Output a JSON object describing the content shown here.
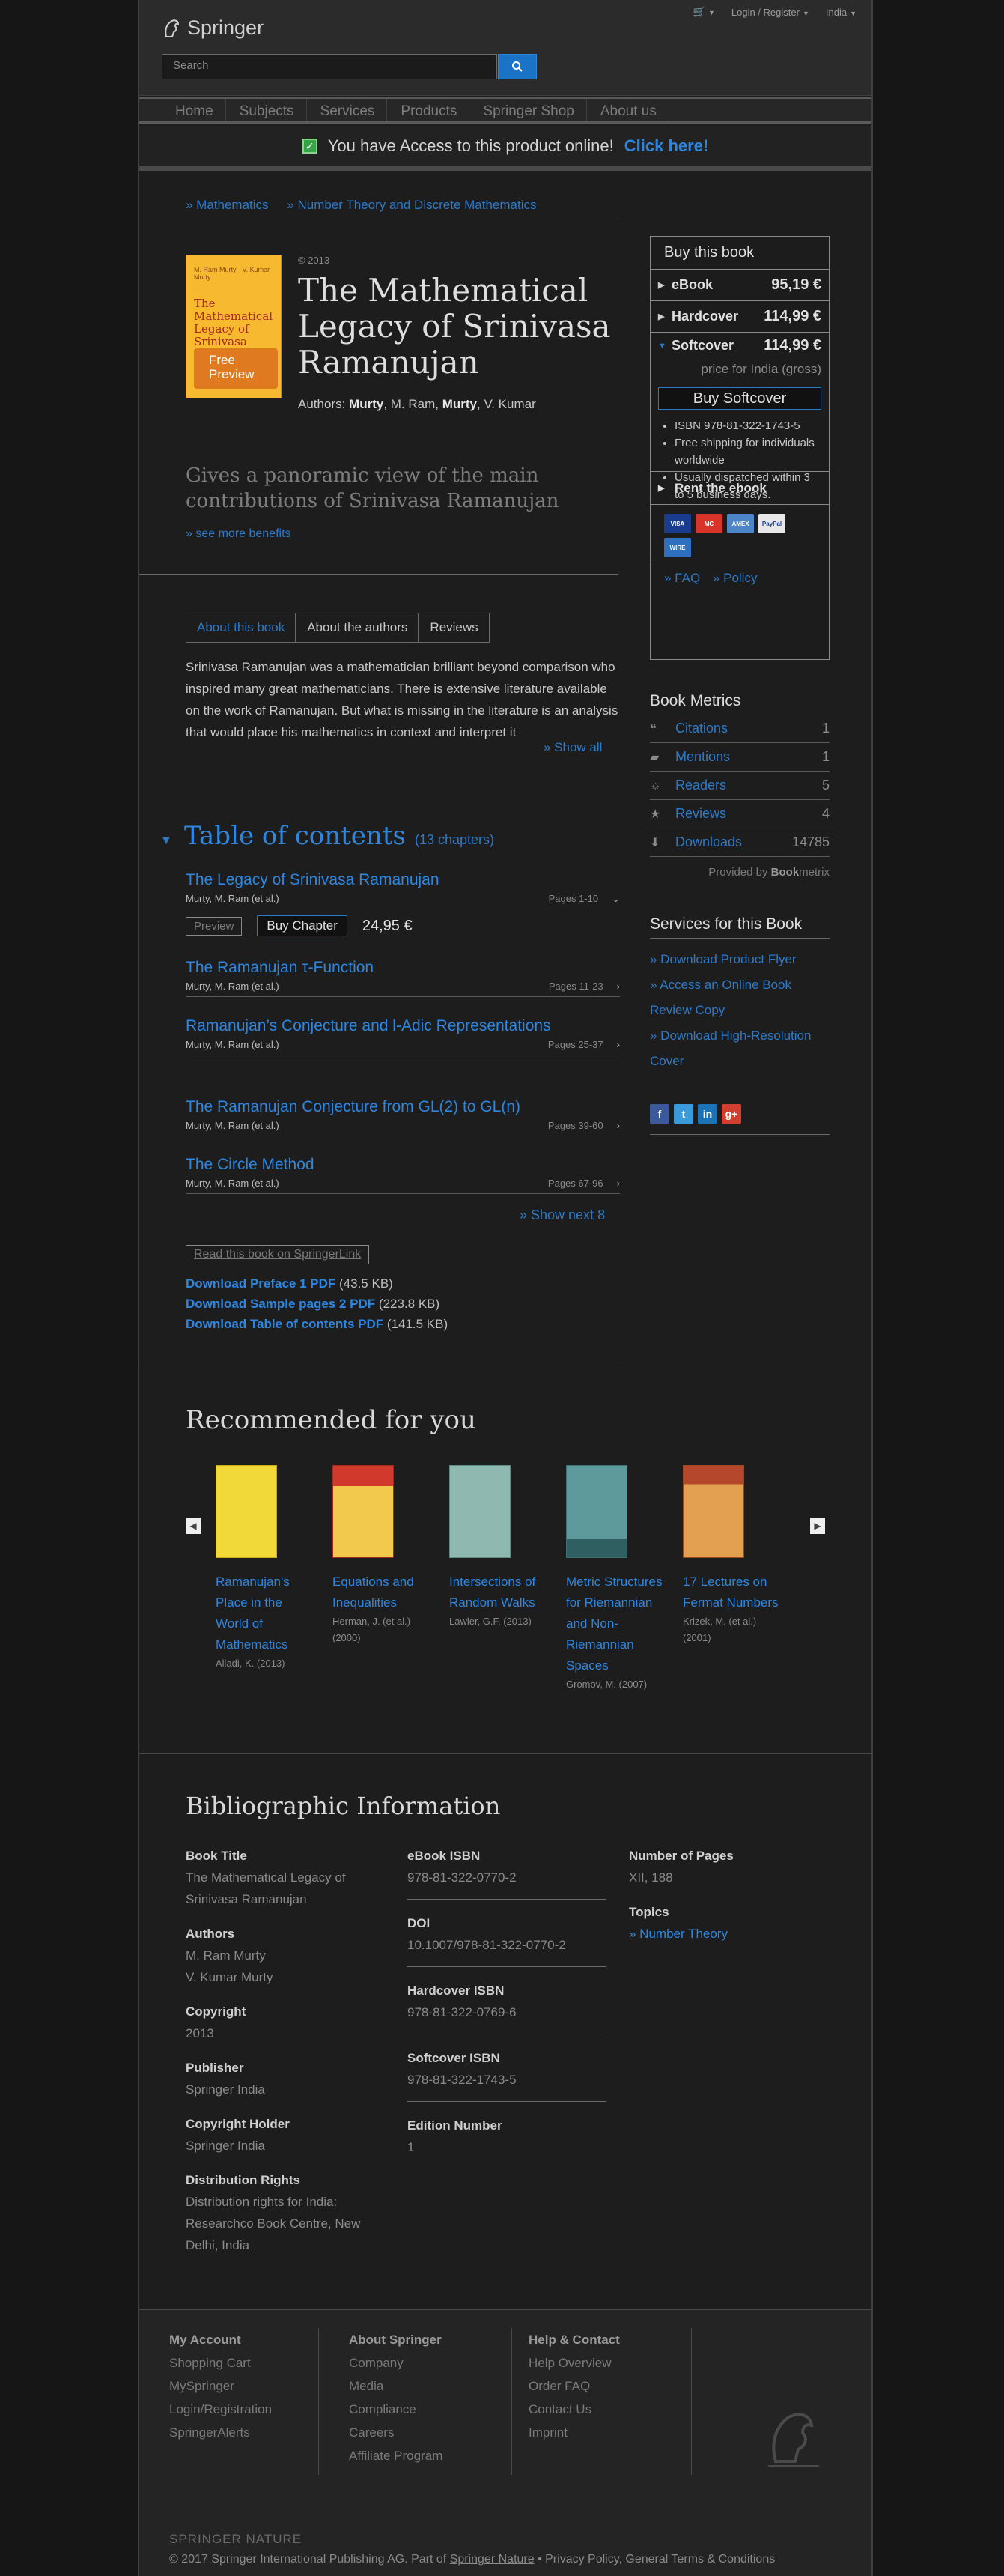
{
  "header": {
    "brand": "Springer",
    "search_placeholder": "Search",
    "login": "Login / Register",
    "region": "India"
  },
  "nav": [
    "Home",
    "Subjects",
    "Services",
    "Products",
    "Springer Shop",
    "About us"
  ],
  "banner": {
    "text": "You have Access to this product online!",
    "link": "Click here!"
  },
  "breadcrumb": [
    "» Mathematics",
    "» Number Theory and Discrete Mathematics"
  ],
  "book": {
    "cover_authors": "M. Ram Murty · V. Kumar Murty",
    "cover_title": "The Mathematical Legacy of Srinivasa Ramanujan",
    "cover_preview": "Free Preview",
    "year": "© 2013",
    "title": "The Mathematical Legacy of Srinivasa Ramanujan",
    "authors_label": "Authors: ",
    "author1_first": "",
    "author1_last": "Murty",
    "author1_rest": ", M. Ram, ",
    "author2_last": "Murty",
    "author2_rest": ", V. Kumar",
    "tagline": "Gives a panoramic view of the main contributions of Srinivasa Ramanujan",
    "see_more": "» see more benefits"
  },
  "tabs": [
    "About this book",
    "About the authors",
    "Reviews"
  ],
  "about": "Srinivasa Ramanujan was a mathematician brilliant beyond comparison who inspired many great mathematicians. There is extensive literature available on the work of Ramanujan. But what is missing in the literature is an analysis that would place his mathematics in context and interpret it",
  "show_all": "» Show all",
  "toc": {
    "title": "Table of contents",
    "count": "(13 chapters)",
    "chapters": [
      {
        "name": "The Legacy of Srinivasa Ramanujan",
        "authors": "Murty, M. Ram (et al.)",
        "pages": "Pages 1-10"
      },
      {
        "name": "The Ramanujan τ-Function",
        "authors": "Murty, M. Ram (et al.)",
        "pages": "Pages 11-23"
      },
      {
        "name": "Ramanujan’s Conjecture and l-Adic Representations",
        "authors": "Murty, M. Ram (et al.)",
        "pages": "Pages 25-37"
      },
      {
        "name": "The Ramanujan Conjecture from GL(2) to GL(n)",
        "authors": "Murty, M. Ram (et al.)",
        "pages": "Pages 39-60"
      },
      {
        "name": "The Circle Method",
        "authors": "Murty, M. Ram (et al.)",
        "pages": "Pages 67-96"
      }
    ],
    "preview": "Preview",
    "buy_chapter": "Buy Chapter",
    "chapter_price": "24,95 €",
    "show_next": "» Show next 8"
  },
  "read_button": "Read this book on SpringerLink",
  "downloads": [
    {
      "label": "Download Preface 1 PDF",
      "size": "(43.5 KB)"
    },
    {
      "label": "Download Sample pages 2 PDF",
      "size": "(223.8 KB)"
    },
    {
      "label": "Download Table of contents PDF",
      "size": "(141.5 KB)"
    }
  ],
  "recommended": {
    "title": "Recommended for you",
    "items": [
      {
        "name": "Ramanujan's Place in the World of Mathematics",
        "author": "Alladi, K. (2013)",
        "color": "#f2d93a"
      },
      {
        "name": "Equations and Inequalities",
        "author": "Herman, J. (et al.) (2000)",
        "color": "#d0392b"
      },
      {
        "name": "Intersections of Random Walks",
        "author": "Lawler, G.F. (2013)",
        "color": "#8fb8b0"
      },
      {
        "name": "Metric Structures for Riemannian and Non-Riemannian Spaces",
        "author": "Gromov, M. (2007)",
        "color": "#5e9a9b"
      },
      {
        "name": "17 Lectures on Fermat Numbers",
        "author": "Krizek, M. (et al.) (2001)",
        "color": "#e3a050"
      }
    ]
  },
  "bib": {
    "title": "Bibliographic Information",
    "col1": [
      {
        "k": "Book Title",
        "v": [
          "The Mathematical Legacy of Srinivasa Ramanujan"
        ]
      },
      {
        "k": "Authors",
        "v": [
          "M. Ram Murty",
          "V. Kumar Murty"
        ]
      },
      {
        "k": "Copyright",
        "v": [
          "2013"
        ]
      },
      {
        "k": "Publisher",
        "v": [
          "Springer India"
        ]
      },
      {
        "k": "Copyright Holder",
        "v": [
          "Springer India"
        ]
      },
      {
        "k": "Distribution Rights",
        "v": [
          "Distribution rights for India: Researchco Book Centre, New Delhi, India"
        ]
      }
    ],
    "col2": [
      {
        "k": "eBook ISBN",
        "v": [
          "978-81-322-0770-2"
        ]
      },
      {
        "k": "DOI",
        "v": [
          "10.1007/978-81-322-0770-2"
        ]
      },
      {
        "k": "Hardcover ISBN",
        "v": [
          "978-81-322-0769-6"
        ]
      },
      {
        "k": "Softcover ISBN",
        "v": [
          "978-81-322-1743-5"
        ]
      },
      {
        "k": "Edition Number",
        "v": [
          "1"
        ]
      }
    ],
    "col3": [
      {
        "k": "Number of Pages",
        "v": [
          "XII, 188"
        ]
      },
      {
        "k": "Topics",
        "v": [
          "» Number Theory"
        ]
      }
    ]
  },
  "buy": {
    "title": "Buy this book",
    "ebook": {
      "label": "eBook",
      "price": "95,19 €"
    },
    "hardcover": {
      "label": "Hardcover",
      "price": "114,99 €"
    },
    "softcover": {
      "label": "Softcover",
      "price": "114,99 €",
      "gross": "price for India (gross)",
      "button": "Buy Softcover"
    },
    "bullets": [
      "ISBN 978-81-322-1743-5",
      "Free shipping for individuals worldwide",
      "Usually dispatched within 3 to 5 business days."
    ],
    "rent": "Rent the ebook",
    "cards": [
      {
        "name": "VISA",
        "color": "#1a3c8f"
      },
      {
        "name": "MC",
        "color": "#d8342a"
      },
      {
        "name": "AMEX",
        "color": "#4d86c8"
      },
      {
        "name": "PayPal",
        "color": "#e8e8e8"
      },
      {
        "name": "WIRE",
        "color": "#2f6fc0"
      }
    ],
    "faq": "» FAQ",
    "policy": "» Policy"
  },
  "metrics": {
    "title": "Book Metrics",
    "items": [
      {
        "label": "Citations",
        "value": "1",
        "icon": "quote-icon"
      },
      {
        "label": "Mentions",
        "value": "1",
        "icon": "speech-icon"
      },
      {
        "label": "Readers",
        "value": "5",
        "icon": "readers-icon"
      },
      {
        "label": "Reviews",
        "value": "4",
        "icon": "star-icon"
      },
      {
        "label": "Downloads",
        "value": "14785",
        "icon": "download-icon"
      }
    ],
    "provided_by": "Provided by ",
    "provider_bold": "Book",
    "provider_rest": "metrix"
  },
  "services": {
    "title": "Services for this Book",
    "links": [
      "» Download Product Flyer",
      "» Access an Online Book Review Copy",
      "» Download High-Resolution Cover"
    ]
  },
  "social": [
    {
      "name": "f",
      "color": "#3b5998"
    },
    {
      "name": "t",
      "color": "#3b9ad9"
    },
    {
      "name": "in",
      "color": "#1b72b4"
    },
    {
      "name": "g+",
      "color": "#d23f31"
    }
  ],
  "footer": {
    "cols": [
      {
        "h": "My Account",
        "items": [
          "Shopping Cart",
          "MySpringer",
          "Login/Registration",
          "SpringerAlerts"
        ]
      },
      {
        "h": "About Springer",
        "items": [
          "Company",
          "Media",
          "Compliance",
          "Careers",
          "Affiliate Program"
        ]
      },
      {
        "h": "Help & Contact",
        "items": [
          "Help Overview",
          "Order FAQ",
          "Contact Us",
          "Imprint"
        ]
      }
    ],
    "nature_logo": "SPRINGER NATURE",
    "copyright_pre": "© 2017 Springer International Publishing AG. Part of ",
    "copyright_link": "Springer Nature",
    "copyright_post": " • Privacy Policy, General Terms & Conditions"
  }
}
